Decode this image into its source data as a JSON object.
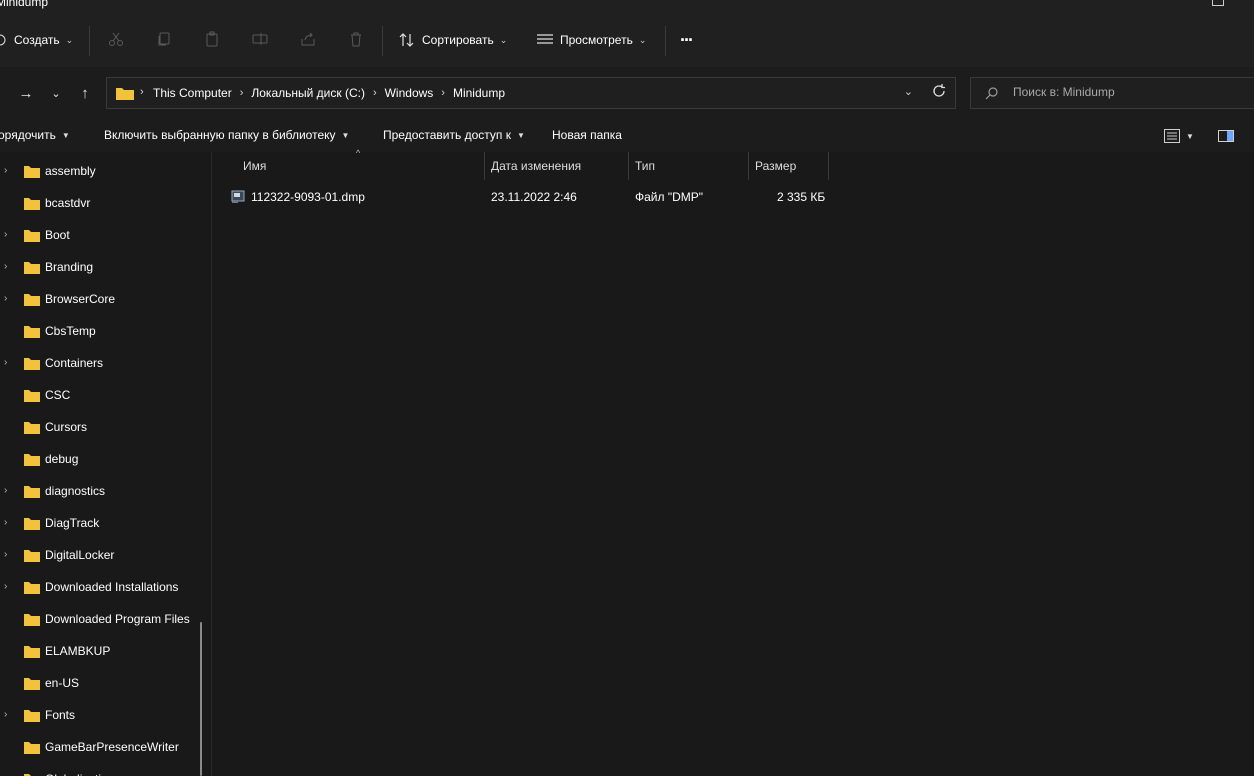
{
  "window": {
    "title": "Minidump"
  },
  "commandbar": {
    "create_label": "Создать",
    "sort_label": "Сортировать",
    "view_label": "Просмотреть",
    "more_label": "···"
  },
  "address": {
    "crumbs": [
      "This Computer",
      "Локальный диск (C:)",
      "Windows",
      "Minidump"
    ]
  },
  "search": {
    "placeholder": "Поиск в: Minidump"
  },
  "secondary": {
    "organize_label": "орядочить",
    "include_label": "Включить выбранную папку в библиотеку",
    "share_label": "Предоставить доступ к",
    "new_folder_label": "Новая папка"
  },
  "tree": [
    {
      "label": "assembly",
      "expandable": true
    },
    {
      "label": "bcastdvr",
      "expandable": false
    },
    {
      "label": "Boot",
      "expandable": true
    },
    {
      "label": "Branding",
      "expandable": true
    },
    {
      "label": "BrowserCore",
      "expandable": true
    },
    {
      "label": "CbsTemp",
      "expandable": false
    },
    {
      "label": "Containers",
      "expandable": true
    },
    {
      "label": "CSC",
      "expandable": false
    },
    {
      "label": "Cursors",
      "expandable": false
    },
    {
      "label": "debug",
      "expandable": false
    },
    {
      "label": "diagnostics",
      "expandable": true
    },
    {
      "label": "DiagTrack",
      "expandable": true
    },
    {
      "label": "DigitalLocker",
      "expandable": true
    },
    {
      "label": "Downloaded Installations",
      "expandable": true
    },
    {
      "label": "Downloaded Program Files",
      "expandable": false
    },
    {
      "label": "ELAMBKUP",
      "expandable": false
    },
    {
      "label": "en-US",
      "expandable": false
    },
    {
      "label": "Fonts",
      "expandable": true
    },
    {
      "label": "GameBarPresenceWriter",
      "expandable": false
    },
    {
      "label": "Globalization",
      "expandable": false
    }
  ],
  "columns": {
    "name": "Имя",
    "date": "Дата изменения",
    "type": "Тип",
    "size": "Размер"
  },
  "files": [
    {
      "name": "112322-9093-01.dmp",
      "date": "23.11.2022 2:46",
      "type": "Файл \"DMP\"",
      "size": "2 335 КБ"
    }
  ],
  "colors": {
    "folder": "#f3c23c",
    "background": "#191919",
    "bar": "#202020"
  }
}
